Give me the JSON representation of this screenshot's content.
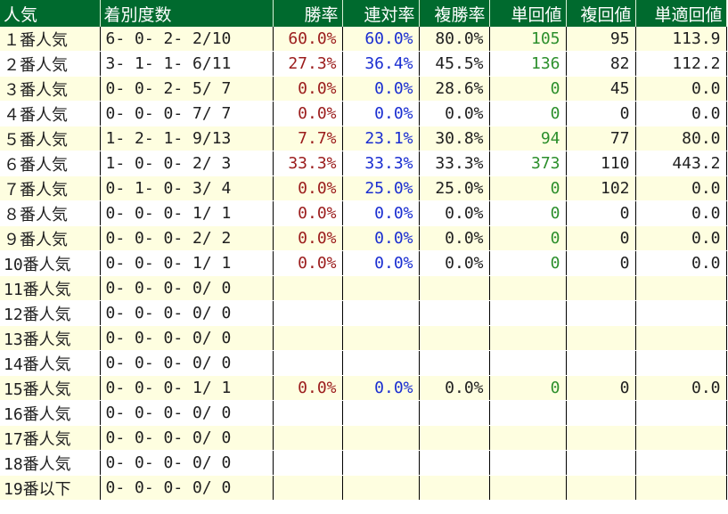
{
  "headers": [
    "人気",
    "着別度数",
    "勝率",
    "連対率",
    "複勝率",
    "単回値",
    "複回値",
    "単適回値"
  ],
  "rows": [
    {
      "label": "１番人気",
      "record": "6- 0- 2- 2/10",
      "win": "60.0%",
      "top2": "60.0%",
      "top3": "80.0%",
      "tan": "105",
      "fuku": "95",
      "tekio": "113.9"
    },
    {
      "label": "２番人気",
      "record": "3- 1- 1- 6/11",
      "win": "27.3%",
      "top2": "36.4%",
      "top3": "45.5%",
      "tan": "136",
      "fuku": "82",
      "tekio": "112.2"
    },
    {
      "label": "３番人気",
      "record": "0- 0- 2- 5/ 7",
      "win": "0.0%",
      "top2": "0.0%",
      "top3": "28.6%",
      "tan": "0",
      "fuku": "45",
      "tekio": "0.0"
    },
    {
      "label": "４番人気",
      "record": "0- 0- 0- 7/ 7",
      "win": "0.0%",
      "top2": "0.0%",
      "top3": "0.0%",
      "tan": "0",
      "fuku": "0",
      "tekio": "0.0"
    },
    {
      "label": "５番人気",
      "record": "1- 2- 1- 9/13",
      "win": "7.7%",
      "top2": "23.1%",
      "top3": "30.8%",
      "tan": "94",
      "fuku": "77",
      "tekio": "80.0"
    },
    {
      "label": "６番人気",
      "record": "1- 0- 0- 2/ 3",
      "win": "33.3%",
      "top2": "33.3%",
      "top3": "33.3%",
      "tan": "373",
      "fuku": "110",
      "tekio": "443.2"
    },
    {
      "label": "７番人気",
      "record": "0- 1- 0- 3/ 4",
      "win": "0.0%",
      "top2": "25.0%",
      "top3": "25.0%",
      "tan": "0",
      "fuku": "102",
      "tekio": "0.0"
    },
    {
      "label": "８番人気",
      "record": "0- 0- 0- 1/ 1",
      "win": "0.0%",
      "top2": "0.0%",
      "top3": "0.0%",
      "tan": "0",
      "fuku": "0",
      "tekio": "0.0"
    },
    {
      "label": "９番人気",
      "record": "0- 0- 0- 2/ 2",
      "win": "0.0%",
      "top2": "0.0%",
      "top3": "0.0%",
      "tan": "0",
      "fuku": "0",
      "tekio": "0.0"
    },
    {
      "label": "10番人気",
      "record": "0- 0- 0- 1/ 1",
      "win": "0.0%",
      "top2": "0.0%",
      "top3": "0.0%",
      "tan": "0",
      "fuku": "0",
      "tekio": "0.0"
    },
    {
      "label": "11番人気",
      "record": "0- 0- 0- 0/ 0",
      "win": "",
      "top2": "",
      "top3": "",
      "tan": "",
      "fuku": "",
      "tekio": ""
    },
    {
      "label": "12番人気",
      "record": "0- 0- 0- 0/ 0",
      "win": "",
      "top2": "",
      "top3": "",
      "tan": "",
      "fuku": "",
      "tekio": ""
    },
    {
      "label": "13番人気",
      "record": "0- 0- 0- 0/ 0",
      "win": "",
      "top2": "",
      "top3": "",
      "tan": "",
      "fuku": "",
      "tekio": ""
    },
    {
      "label": "14番人気",
      "record": "0- 0- 0- 0/ 0",
      "win": "",
      "top2": "",
      "top3": "",
      "tan": "",
      "fuku": "",
      "tekio": ""
    },
    {
      "label": "15番人気",
      "record": "0- 0- 0- 1/ 1",
      "win": "0.0%",
      "top2": "0.0%",
      "top3": "0.0%",
      "tan": "0",
      "fuku": "0",
      "tekio": "0.0"
    },
    {
      "label": "16番人気",
      "record": "0- 0- 0- 0/ 0",
      "win": "",
      "top2": "",
      "top3": "",
      "tan": "",
      "fuku": "",
      "tekio": ""
    },
    {
      "label": "17番人気",
      "record": "0- 0- 0- 0/ 0",
      "win": "",
      "top2": "",
      "top3": "",
      "tan": "",
      "fuku": "",
      "tekio": ""
    },
    {
      "label": "18番人気",
      "record": "0- 0- 0- 0/ 0",
      "win": "",
      "top2": "",
      "top3": "",
      "tan": "",
      "fuku": "",
      "tekio": ""
    },
    {
      "label": "19番以下",
      "record": "0- 0- 0- 0/ 0",
      "win": "",
      "top2": "",
      "top3": "",
      "tan": "",
      "fuku": "",
      "tekio": ""
    }
  ],
  "colors": {
    "header_bg": "#006a2e",
    "header_text": "#ffffff",
    "row_odd": "#fefee0",
    "row_even": "#ffffff",
    "win_rate": "#9b1c1c",
    "top2_rate": "#1a2ed1",
    "tan_value": "#2c8f2c"
  }
}
